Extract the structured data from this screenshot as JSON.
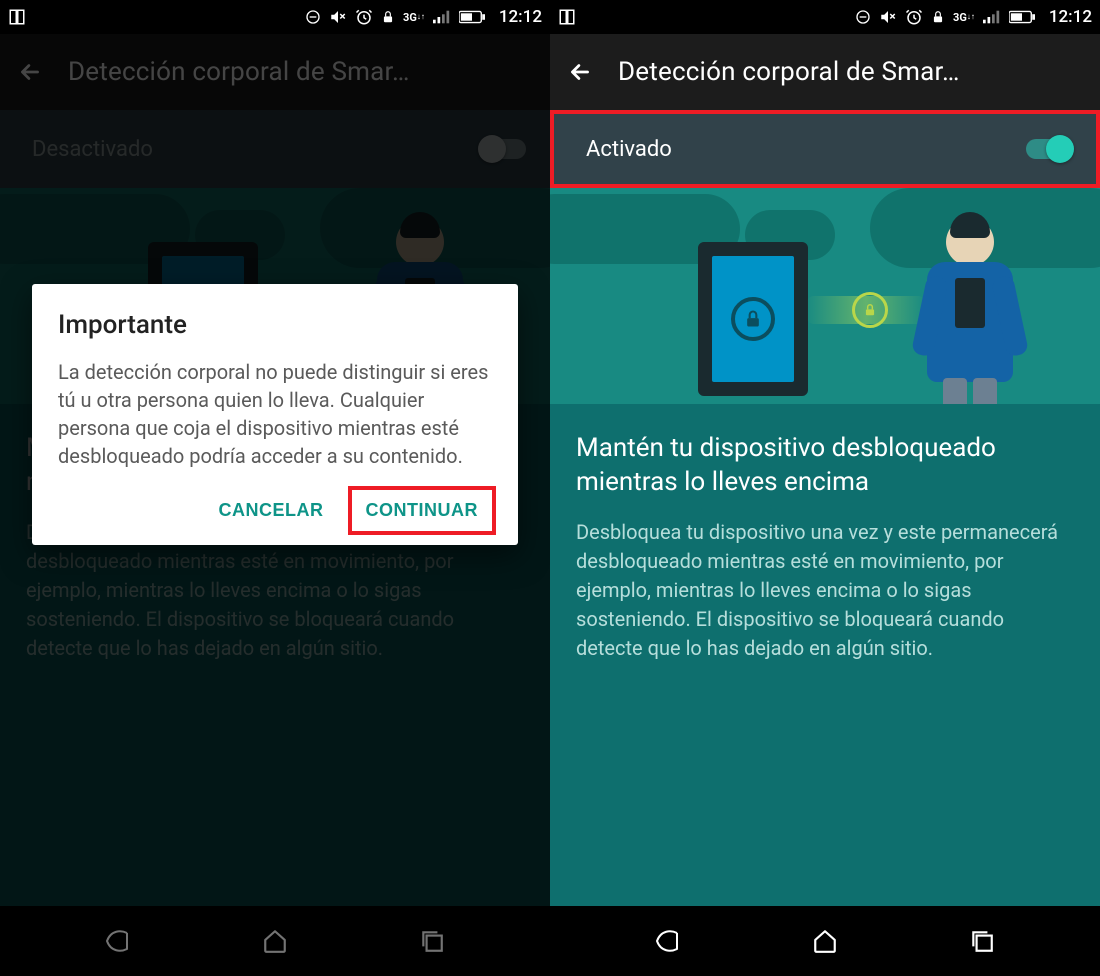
{
  "statusbar": {
    "time": "12:12",
    "network_label": "3G"
  },
  "appbar": {
    "title": "Detección corporal de Smar…"
  },
  "left": {
    "toggle_label": "Desactivado",
    "toggle_state": "off",
    "heading": "Mantén tu dispositivo desbloqueado mientras lo lleves encima",
    "description": "Desbloquea tu dispositivo una vez y este permanecerá desbloqueado mientras esté en movimiento, por ejemplo, mientras lo lleves encima o lo sigas sosteniendo. El dispositivo se bloqueará cuando detecte que lo has dejado en algún sitio.",
    "dialog": {
      "title": "Importante",
      "body": "La detección corporal no puede distinguir si eres tú u otra persona quien lo lleva. Cualquier persona que coja el dispositivo mientras esté desbloqueado podría acceder a su contenido.",
      "cancel": "CANCELAR",
      "continue": "CONTINUAR"
    }
  },
  "right": {
    "toggle_label": "Activado",
    "toggle_state": "on",
    "heading": "Mantén tu dispositivo desbloqueado mientras lo lleves encima",
    "description": "Desbloquea tu dispositivo una vez y este permanecerá desbloqueado mientras esté en movimiento, por ejemplo, mientras lo lleves encima o lo sigas sosteniendo. El dispositivo se bloqueará cuando detecte que lo has dejado en algún sitio."
  },
  "colors": {
    "accent_teal": "#0e9488",
    "switch_on": "#24cdb7",
    "highlight": "#ee1c25"
  }
}
